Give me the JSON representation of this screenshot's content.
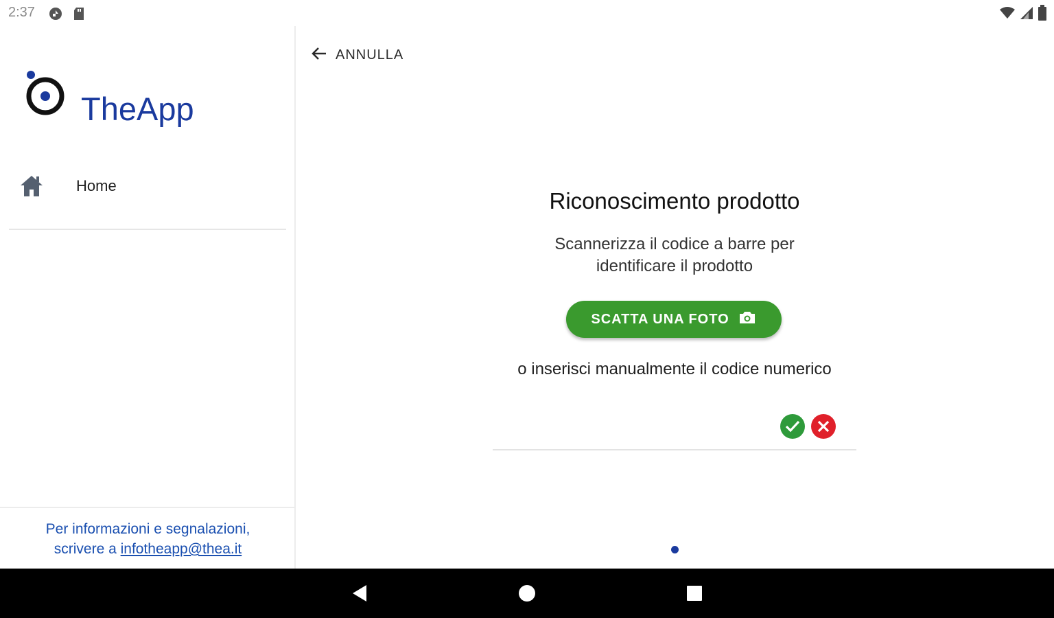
{
  "status_bar": {
    "time": "2:37",
    "icons_left": [
      "sync-icon",
      "sd-card-icon"
    ],
    "icons_right": [
      "wifi-icon",
      "signal-icon",
      "battery-icon"
    ]
  },
  "sidebar": {
    "app_name": "TheApp",
    "logo": "theapp-logo",
    "nav_items": [
      {
        "label": "Home",
        "icon": "home-icon"
      }
    ],
    "footer": {
      "line1": "Per informazioni e segnalazioni,",
      "line2_prefix": "scrivere a ",
      "email": "infotheapp@thea.it"
    }
  },
  "main": {
    "cancel_label": "ANNULLA",
    "title": "Riconoscimento prodotto",
    "subtitle_line1": "Scannerizza il codice a barre per",
    "subtitle_line2": "identificare il prodotto",
    "photo_button_label": "SCATTA UNA FOTO",
    "or_text": "o inserisci manualmente il codice numerico",
    "code_input_value": "",
    "code_input_placeholder": "",
    "page_indicator": {
      "current": 1,
      "total": 1
    }
  },
  "colors": {
    "brand_blue": "#1a3a9e",
    "primary_green": "#3a9a2e",
    "confirm_green": "#2e9a3a",
    "cancel_red": "#e0202a",
    "link_blue": "#1a4fb0"
  },
  "nav_bar": {
    "buttons": [
      "back-icon",
      "home-circle-icon",
      "recents-icon"
    ]
  }
}
